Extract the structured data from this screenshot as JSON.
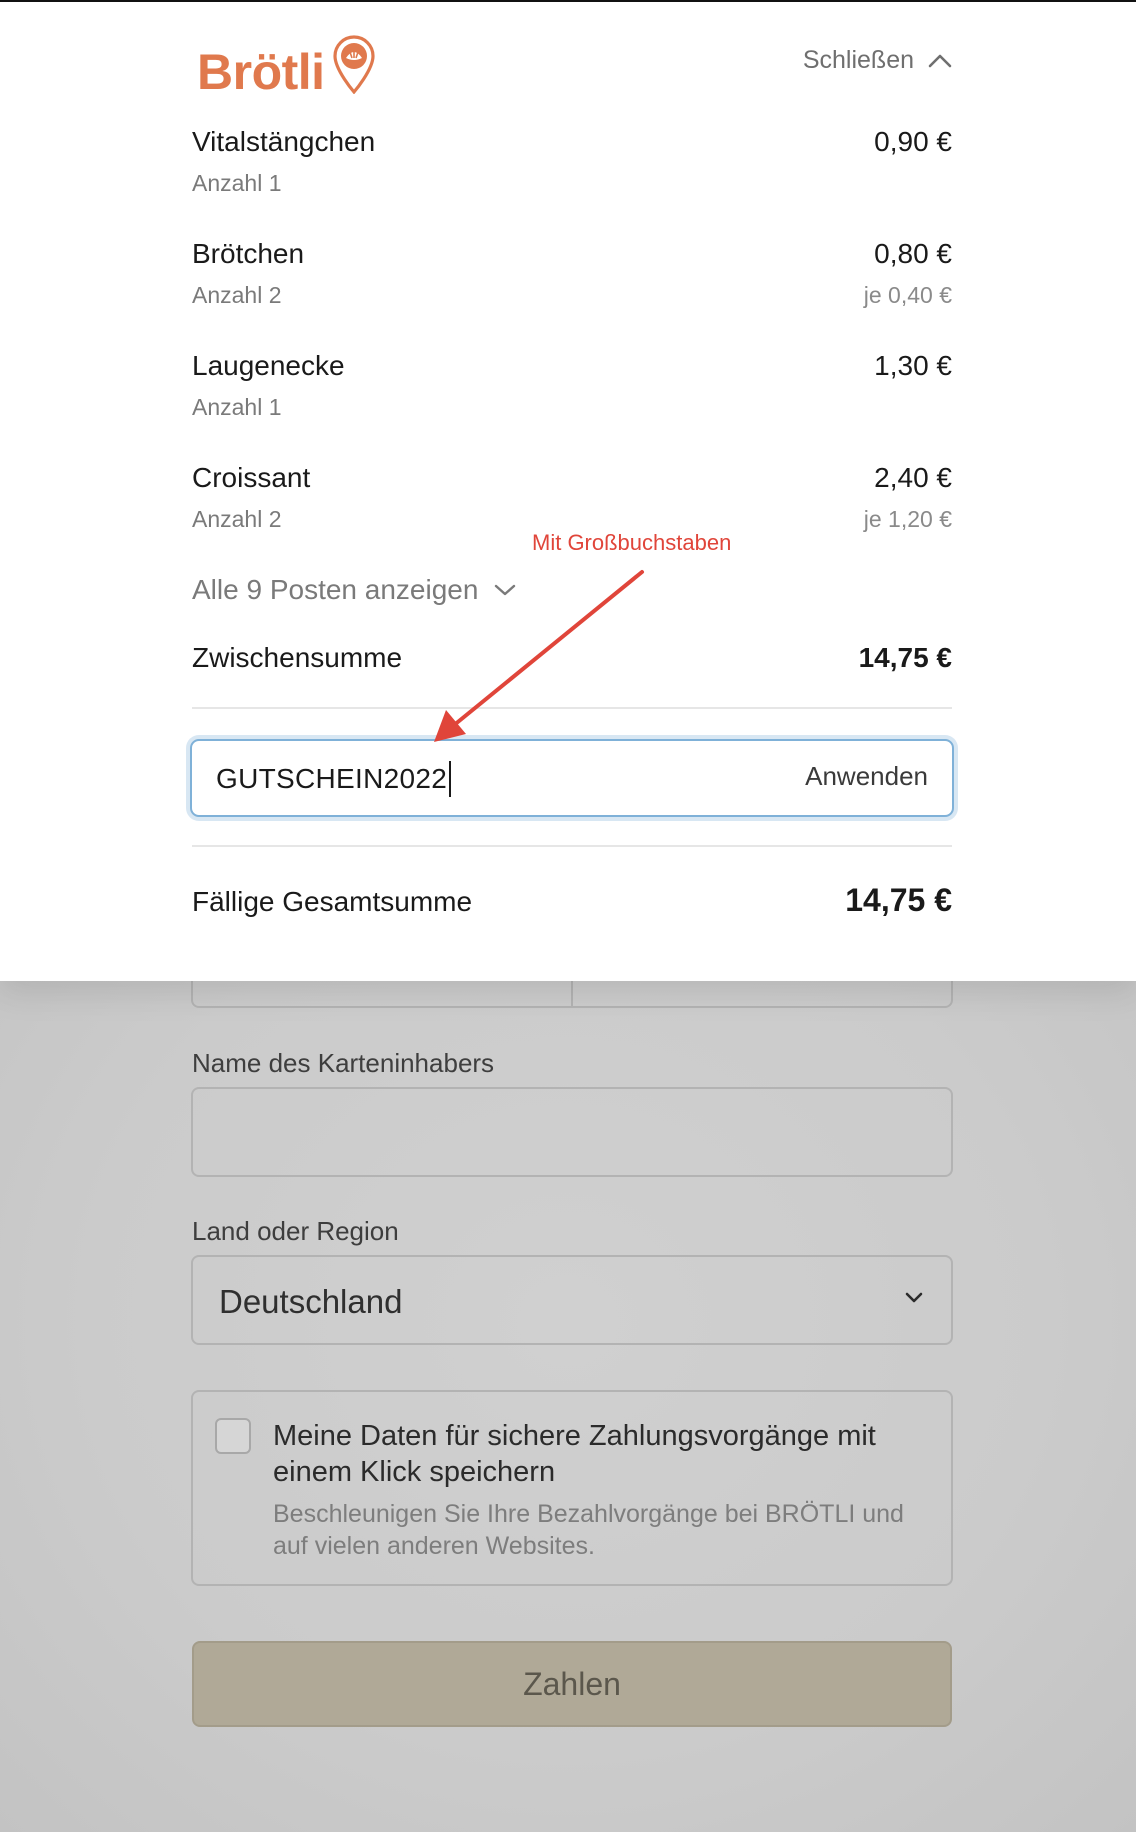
{
  "header": {
    "brand": "Brötli",
    "close_label": "Schließen"
  },
  "items": [
    {
      "name": "Vitalstängchen",
      "qty": "Anzahl 1",
      "price": "0,90 €",
      "unit": ""
    },
    {
      "name": "Brötchen",
      "qty": "Anzahl 2",
      "price": "0,80 €",
      "unit": "je 0,40 €"
    },
    {
      "name": "Laugenecke",
      "qty": "Anzahl 1",
      "price": "1,30 €",
      "unit": ""
    },
    {
      "name": "Croissant",
      "qty": "Anzahl 2",
      "price": "2,40 €",
      "unit": "je 1,20 €"
    }
  ],
  "show_all_label": "Alle 9 Posten anzeigen",
  "subtotal": {
    "label": "Zwischensumme",
    "value": "14,75 €"
  },
  "coupon": {
    "value": "GUTSCHEIN2022",
    "apply_label": "Anwenden"
  },
  "total": {
    "label": "Fällige Gesamtsumme",
    "value": "14,75 €"
  },
  "annotation": {
    "text": "Mit Großbuchstaben",
    "color": "#e0453a"
  },
  "form": {
    "cardholder_label": "Name des Karteninhabers",
    "cardholder_value": "",
    "country_label": "Land oder Region",
    "country_value": "Deutschland",
    "save_title": "Meine Daten für sichere Zahlungsvorgänge mit einem Klick speichern",
    "save_subtitle": "Beschleunigen Sie Ihre Bezahlvorgänge bei BRÖTLI und auf vielen anderen Websites.",
    "save_checked": false,
    "pay_label": "Zahlen"
  },
  "colors": {
    "brand": "#e0794d",
    "focus": "#7fb1d8",
    "pay_button": "#b0a997"
  }
}
